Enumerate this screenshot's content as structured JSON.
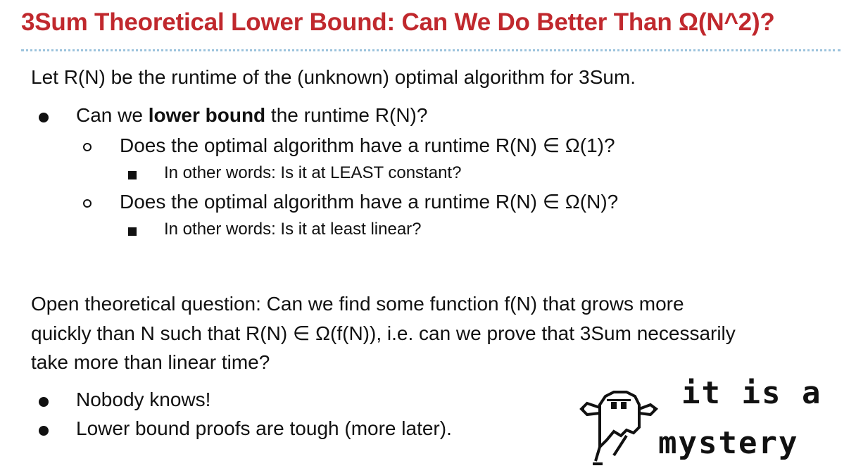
{
  "slide": {
    "title": "3Sum Theoretical Lower Bound: Can We Do Better Than Ω(N^2)?",
    "intro": "Let R(N) be the runtime of the (unknown) optimal algorithm for 3Sum.",
    "bullets": [
      {
        "prefix": "Can we ",
        "bold": "lower bound",
        "suffix": " the runtime R(N)?",
        "sub": [
          {
            "text": "Does the optimal algorithm have a runtime R(N) ∈ Ω(1)?",
            "note": "In other words: Is it at LEAST constant?"
          },
          {
            "text": "Does the optimal algorithm have a runtime R(N) ∈ Ω(N)?",
            "note": "In other words: Is it at least linear?"
          }
        ]
      }
    ],
    "question_lines": [
      "Open theoretical question: Can we find some function f(N) that grows more",
      "quickly than N such that R(N) ∈ Ω(f(N)), i.e. can we prove that 3Sum necessarily",
      "take more than linear time?"
    ],
    "answers": [
      "Nobody knows!",
      "Lower bound proofs are tough (more later)."
    ],
    "mystery": {
      "line1": "it is a",
      "line2": "mystery"
    }
  }
}
